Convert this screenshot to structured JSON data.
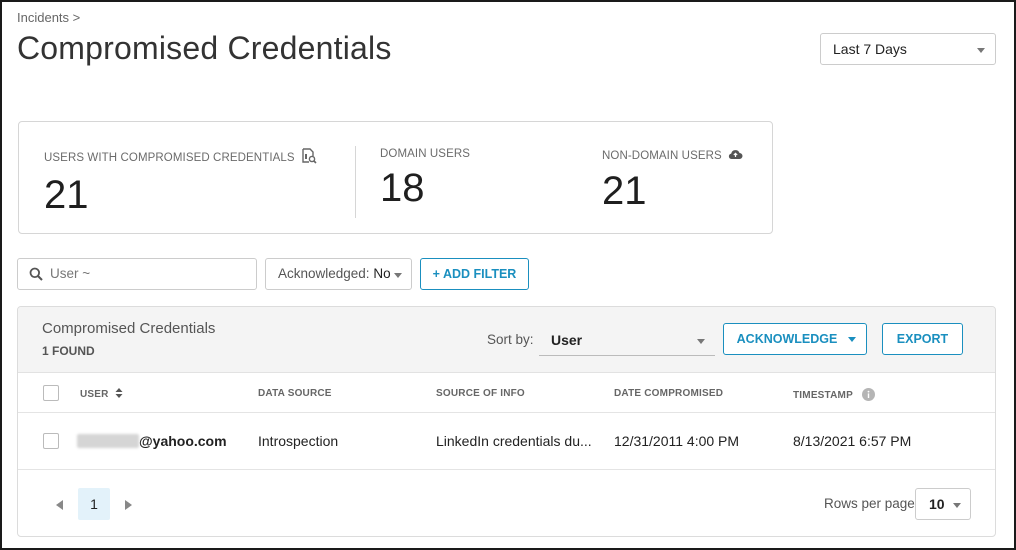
{
  "breadcrumb": "Incidents >",
  "page_title": "Compromised Credentials",
  "date_range": {
    "selected": "Last 7 Days"
  },
  "stats": {
    "compromised_users": {
      "label": "USERS WITH COMPROMISED CREDENTIALS",
      "value": "21",
      "icon": "report-search-icon"
    },
    "domain_users": {
      "label": "DOMAIN USERS",
      "value": "18"
    },
    "non_domain_users": {
      "label": "NON-DOMAIN USERS",
      "value": "21",
      "icon": "cloud-upload-icon"
    }
  },
  "filters": {
    "search_placeholder": "User ~",
    "acknowledged_label": "Acknowledged:",
    "acknowledged_value": "No",
    "add_filter_label": "+ ADD FILTER"
  },
  "panel": {
    "title": "Compromised Credentials",
    "count": "1 FOUND",
    "sort_label": "Sort by:",
    "sort_value": "User",
    "acknowledge_label": "ACKNOWLEDGE",
    "export_label": "EXPORT"
  },
  "table": {
    "columns": [
      "USER",
      "DATA SOURCE",
      "SOURCE OF INFO",
      "DATE COMPROMISED",
      "TIMESTAMP"
    ],
    "rows": [
      {
        "user_domain": "@yahoo.com",
        "data_source": "Introspection",
        "source_of_info": "LinkedIn credentials du...",
        "date_compromised": "12/31/2011 4:00 PM",
        "timestamp": "8/13/2021 6:57 PM"
      }
    ]
  },
  "pagination": {
    "current_page": "1",
    "rows_per_page_label": "Rows per page:",
    "rows_per_page_value": "10"
  },
  "colors": {
    "accent": "#1a8fbf",
    "page_highlight": "#e3f2fa"
  }
}
